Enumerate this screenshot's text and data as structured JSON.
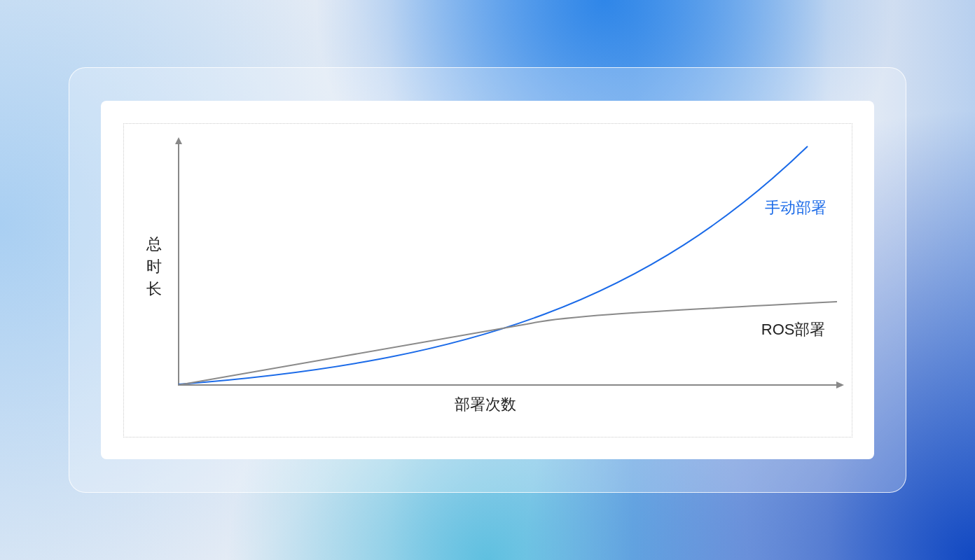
{
  "chart": {
    "y_label": "总时长",
    "x_label": "部署次数",
    "series": [
      {
        "name": "手动部署",
        "kind": "manual",
        "color": "#1a6ae8"
      },
      {
        "name": "ROS部署",
        "kind": "ros",
        "color": "#8a8a8a"
      }
    ]
  }
}
